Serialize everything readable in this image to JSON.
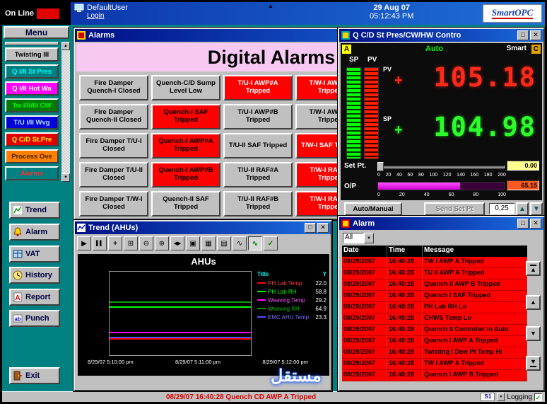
{
  "top_bar": {
    "online_label": "On Line",
    "user": "DefaultUser",
    "login_label": "Login",
    "date": "29 Aug 07",
    "time": "05:12:43 PM",
    "brand": "SmartOPC"
  },
  "sidebar": {
    "menu_label": "Menu",
    "nav_items": [
      {
        "label": "Twisting III"
      },
      {
        "label": "Q I/II St Pres"
      },
      {
        "label": "Q I/II Hot Wa"
      },
      {
        "label": "Tw I/II/III CW"
      },
      {
        "label": "T/U I/II Wvg"
      },
      {
        "label": "Q C/D St.Pre"
      },
      {
        "label": "Process Ove"
      },
      {
        "label": "Alarms"
      }
    ],
    "tools": [
      {
        "label": "Trend"
      },
      {
        "label": "Alarm"
      },
      {
        "label": "VAT"
      },
      {
        "label": "History"
      },
      {
        "label": "Report"
      },
      {
        "label": "Punch"
      }
    ],
    "exit_label": "Exit"
  },
  "alarms_window": {
    "title": "Alarms",
    "header": "Digital Alarms",
    "buttons": [
      {
        "label": "Fire Damper Quench-I Closed",
        "state": "normal"
      },
      {
        "label": "Quench-C/D Sump Level Low",
        "state": "normal"
      },
      {
        "label": "T/U-I AWP#A Tripped",
        "state": "alarm"
      },
      {
        "label": "T/W-I AWP#A Tripped",
        "state": "alarm"
      },
      {
        "label": "Fire Damper Quench-II Closed",
        "state": "normal"
      },
      {
        "label": "Quench-I SAF Tripped",
        "state": "alarm"
      },
      {
        "label": "T/U-I AWP#B Tripped",
        "state": "normal"
      },
      {
        "label": "T/W-I AWP#B Tripped",
        "state": "normal"
      },
      {
        "label": "Fire Damper T/U-I Closed",
        "state": "normal"
      },
      {
        "label": "Quench-I AWP#A Tripped",
        "state": "alarm"
      },
      {
        "label": "T/U-II SAF Tripped",
        "state": "normal"
      },
      {
        "label": "T/W-I SAF Tripped",
        "state": "alarm"
      },
      {
        "label": "Fire Damper T/U-II Closed",
        "state": "normal"
      },
      {
        "label": "Quench-I AWP#B Tripped",
        "state": "alarm"
      },
      {
        "label": "T/U-II RAF#A Tripped",
        "state": "normal"
      },
      {
        "label": "T/W-I RAF#A Tripped",
        "state": "alarm"
      },
      {
        "label": "Fire Damper T/W-I Closed",
        "state": "normal"
      },
      {
        "label": "Quench-II SAF Tripped",
        "state": "normal"
      },
      {
        "label": "T/U-II RAF#B Tripped",
        "state": "normal"
      },
      {
        "label": "T/W-I RAF#B Tripped",
        "state": "alarm"
      }
    ]
  },
  "control_window": {
    "title": "Q C/D St Pres/CW/HW Contro",
    "tag_left": "A",
    "tag_right": "C",
    "mode": "Auto",
    "brand": "Smart",
    "sp_label": "SP",
    "pv_label": "PV",
    "pv_plus": "+",
    "sp_plus": "+",
    "pv_value": "105.18",
    "sp_value": "104.98",
    "setpt_label": "Set Pt.",
    "setpt_value": "0.00",
    "setpt_scale": [
      "0",
      "20",
      "40",
      "60",
      "80",
      "100",
      "120",
      "140",
      "160",
      "180",
      "200"
    ],
    "op_label": "O/P",
    "op_value": "65.15",
    "op_percent": 65,
    "op_scale": [
      "0",
      "20",
      "40",
      "60",
      "80",
      "100"
    ],
    "auto_manual_label": "Auto/Manual",
    "send_setpt_label": "Send Set Pt",
    "step_value": "0,25"
  },
  "trend_window": {
    "title": "Trend (AHUs)",
    "chart_title": "AHUs",
    "legend_header": {
      "name": "Title",
      "value": "Y"
    },
    "series": [
      {
        "name": "PH Lab Temp",
        "value": "22.0",
        "color": "#ff0000"
      },
      {
        "name": "PH Lab RH",
        "value": "58.8",
        "color": "#00ff00"
      },
      {
        "name": "Weaving Temp",
        "value": "29.2",
        "color": "#ff00ff"
      },
      {
        "name": "Weaving RH",
        "value": "64.9",
        "color": "#00a000"
      },
      {
        "name": "EMC AHU Temp",
        "value": "23.3",
        "color": "#5050ff"
      }
    ],
    "x_labels": [
      "8/29/07 5:10:00 pm",
      "8/29/07 5:11:00 pm",
      "8/29/07 5:12:00 pm"
    ]
  },
  "chart_data": {
    "type": "line",
    "title": "AHUs",
    "x": [
      "8/29/07 5:10:00 pm",
      "8/29/07 5:11:00 pm",
      "8/29/07 5:12:00 pm"
    ],
    "ylim": [
      0,
      100
    ],
    "series": [
      {
        "name": "PH Lab Temp",
        "color": "#ff0000",
        "values": [
          22.0,
          22.0,
          22.0
        ]
      },
      {
        "name": "PH Lab RH",
        "color": "#00ff00",
        "values": [
          58.8,
          58.8,
          58.8
        ]
      },
      {
        "name": "Weaving Temp",
        "color": "#ff00ff",
        "values": [
          29.2,
          29.2,
          29.2
        ]
      },
      {
        "name": "Weaving RH",
        "color": "#00a000",
        "values": [
          64.9,
          64.9,
          64.9
        ]
      },
      {
        "name": "EMC AHU Temp",
        "color": "#5050ff",
        "values": [
          23.3,
          23.3,
          23.3
        ]
      }
    ]
  },
  "alarm_list_window": {
    "title": "Alarm",
    "filter_value": "All",
    "columns": [
      "Date",
      "Time",
      "Message"
    ],
    "rows": [
      {
        "date": "08/29/2007",
        "time": "16:40:28",
        "message": "TW I AWP A Tripped"
      },
      {
        "date": "08/29/2007",
        "time": "16:40:28",
        "message": "TU II AWP A Tripped"
      },
      {
        "date": "08/29/2007",
        "time": "16:40:28",
        "message": "Quench II AWP B Tripped"
      },
      {
        "date": "08/29/2007",
        "time": "16:40:28",
        "message": "Quench I SAF Tripped"
      },
      {
        "date": "08/29/2007",
        "time": "16:40:28",
        "message": "PH Lab RH Lo"
      },
      {
        "date": "08/29/2007",
        "time": "16:40:28",
        "message": "CHWS Temp Lo"
      },
      {
        "date": "08/29/2007",
        "time": "16:40:28",
        "message": "Quench II Controller in Auto"
      },
      {
        "date": "08/29/2007",
        "time": "16:40:28",
        "message": "Quench I AWP A Tripped"
      },
      {
        "date": "08/29/2007",
        "time": "16:40:28",
        "message": "Twisting I Dew Pt Temp Hi"
      },
      {
        "date": "08/29/2007",
        "time": "16:40:28",
        "message": "TW I AWP A Tripped"
      },
      {
        "date": "08/29/2007",
        "time": "16:40:28",
        "message": "Quench I AWP B Tripped"
      }
    ]
  },
  "status_bar": {
    "alarm_text": "08/29/07  16:40:28  Quench CD AWP A Tripped",
    "logo": "S1",
    "logging_label": "Logging"
  },
  "watermark": "مستقل",
  "icons": {
    "minimize": "_",
    "maximize": "□",
    "close": "✕",
    "play": "▶",
    "pause": "▌▌",
    "cursor": "+",
    "zoom_area": "⊞",
    "zoom_out": "⊖",
    "zoom_in": "⊕",
    "pan": "◀▶",
    "copy": "▣",
    "save": "▦",
    "print": "▤",
    "wave": "∿",
    "check": "✓",
    "combo_arrow": "▼",
    "spin_up": "▲",
    "spin_down": "▼",
    "scroll_up": "▲",
    "scroll_down": "▼",
    "overview_marker": "▲"
  }
}
